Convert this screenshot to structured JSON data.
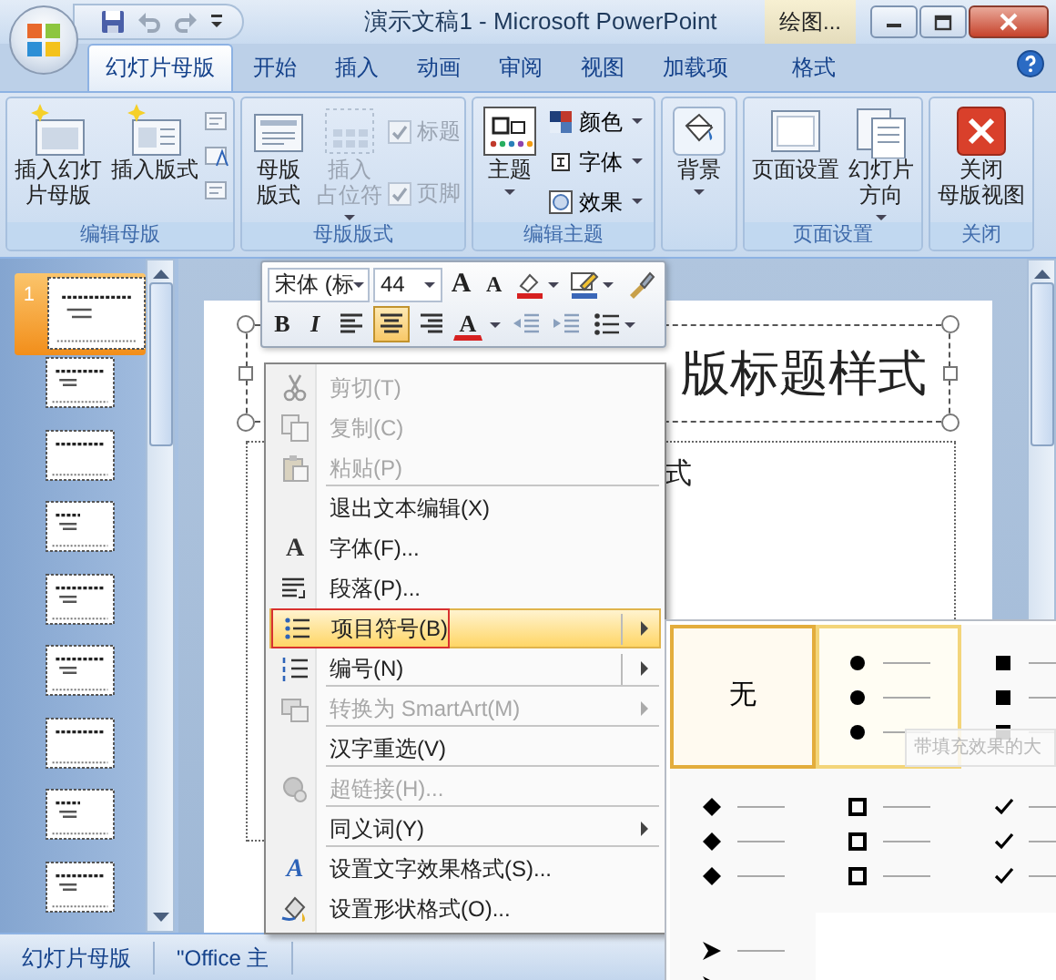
{
  "window": {
    "title": "演示文稿1 - Microsoft PowerPoint",
    "contextual_tab": "绘图..."
  },
  "tabs": [
    {
      "label": "幻灯片母版",
      "selected": true
    },
    {
      "label": "开始",
      "selected": false
    },
    {
      "label": "插入",
      "selected": false
    },
    {
      "label": "动画",
      "selected": false
    },
    {
      "label": "审阅",
      "selected": false
    },
    {
      "label": "视图",
      "selected": false
    },
    {
      "label": "加载项",
      "selected": false
    },
    {
      "label": "格式",
      "selected": false
    }
  ],
  "ribbon": [
    {
      "label": "编辑母版",
      "controls": [
        {
          "kind": "large",
          "label": [
            "插入幻灯",
            "片母版"
          ],
          "disabled": false,
          "dropdown": false
        },
        {
          "kind": "large",
          "label": [
            "插入版式"
          ],
          "disabled": false,
          "dropdown": false
        },
        {
          "kind": "icon-stack"
        }
      ]
    },
    {
      "label": "母版版式",
      "controls": [
        {
          "kind": "large",
          "label": [
            "母版",
            "版式"
          ],
          "disabled": false,
          "dropdown": false
        },
        {
          "kind": "large",
          "label": [
            "插入",
            "占位符"
          ],
          "disabled": true,
          "dropdown": true
        },
        {
          "kind": "checkboxes",
          "items": [
            {
              "label": "标题",
              "checked": true,
              "disabled": true
            },
            {
              "label": "页脚",
              "checked": true,
              "disabled": true
            }
          ]
        }
      ]
    },
    {
      "label": "编辑主题",
      "controls": [
        {
          "kind": "large",
          "label": [
            "主题"
          ],
          "disabled": false,
          "dropdown": true
        },
        {
          "kind": "small-list",
          "items": [
            {
              "label": "颜色"
            },
            {
              "label": "字体"
            },
            {
              "label": "效果"
            }
          ]
        }
      ]
    },
    {
      "controls": [
        {
          "kind": "large",
          "label": [
            "背景"
          ],
          "disabled": false,
          "dropdown": true
        }
      ]
    },
    {
      "label": "页面设置",
      "controls": [
        {
          "kind": "large",
          "label": [
            "页面设置"
          ],
          "disabled": false,
          "dropdown": false
        },
        {
          "kind": "large",
          "label": [
            "幻灯片",
            "方向"
          ],
          "disabled": false,
          "dropdown": true
        }
      ]
    },
    {
      "label": "关闭",
      "controls": [
        {
          "kind": "large",
          "label": [
            "关闭",
            "母版视图"
          ],
          "disabled": false,
          "dropdown": false
        }
      ]
    }
  ],
  "slides_pane": {
    "thumbnails": [
      {
        "kind": "master",
        "number": "1",
        "selected": true
      },
      {
        "kind": "layout",
        "selected": false
      },
      {
        "kind": "layout",
        "selected": false
      },
      {
        "kind": "layout",
        "selected": false
      },
      {
        "kind": "layout",
        "selected": false
      },
      {
        "kind": "layout",
        "selected": false
      },
      {
        "kind": "layout",
        "selected": false
      },
      {
        "kind": "layout",
        "selected": false
      },
      {
        "kind": "layout",
        "selected": false
      }
    ]
  },
  "slide": {
    "title": "版标题样式",
    "body": "式"
  },
  "mini_toolbar": {
    "font": "宋体 (标",
    "size": "44",
    "row1": [
      {
        "kind": "grow",
        "label": "A"
      },
      {
        "kind": "shrink",
        "label": "A"
      },
      {
        "kind": "highlight"
      },
      {
        "kind": "color-pen"
      },
      {
        "kind": "painter"
      }
    ],
    "row2": [
      {
        "kind": "bold",
        "label": "B",
        "selected": false
      },
      {
        "kind": "italic",
        "label": "I",
        "selected": false
      },
      {
        "kind": "align-left",
        "selected": false
      },
      {
        "kind": "align-center",
        "selected": true
      },
      {
        "kind": "align-right",
        "selected": false
      },
      {
        "kind": "font-color",
        "label": "A",
        "selected": false
      },
      {
        "kind": "outdent",
        "selected": false
      },
      {
        "kind": "indent",
        "selected": false
      },
      {
        "kind": "bullets",
        "selected": false
      }
    ]
  },
  "context_menu": [
    {
      "label": "剪切(T)",
      "disabled": true,
      "submenu": false,
      "selected": false,
      "separator": false
    },
    {
      "label": "复制(C)",
      "disabled": true,
      "submenu": false,
      "selected": false,
      "separator": false
    },
    {
      "label": "粘贴(P)",
      "disabled": true,
      "submenu": false,
      "selected": false,
      "separator": true
    },
    {
      "label": "退出文本编辑(X)",
      "disabled": false,
      "submenu": false,
      "selected": false,
      "separator": false
    },
    {
      "label": "字体(F)...",
      "icon_text": "A",
      "disabled": false,
      "submenu": false,
      "selected": false,
      "separator": false
    },
    {
      "label": "段落(P)...",
      "disabled": false,
      "submenu": false,
      "selected": false,
      "separator": false
    },
    {
      "label": "项目符号(B)",
      "disabled": false,
      "submenu": true,
      "selected": true,
      "separator": false
    },
    {
      "label": "编号(N)",
      "disabled": false,
      "submenu": true,
      "selected": false,
      "separator": true
    },
    {
      "label": "转换为 SmartArt(M)",
      "disabled": true,
      "submenu": true,
      "selected": false,
      "separator": true
    },
    {
      "label": "汉字重选(V)",
      "disabled": false,
      "submenu": false,
      "selected": false,
      "separator": true
    },
    {
      "label": "超链接(H)...",
      "disabled": true,
      "submenu": false,
      "selected": false,
      "separator": true
    },
    {
      "label": "同义词(Y)",
      "disabled": false,
      "submenu": true,
      "selected": false,
      "separator": true
    },
    {
      "label": "设置文字效果格式(S)...",
      "icon_text": "A",
      "disabled": false,
      "submenu": false,
      "selected": false,
      "separator": false
    },
    {
      "label": "设置形状格式(O)...",
      "disabled": false,
      "submenu": false,
      "selected": false,
      "separator": false
    }
  ],
  "bullet_gallery": {
    "options": [
      {
        "kind": "none",
        "label": "无",
        "selected": true,
        "hovered": false
      },
      {
        "kind": "filled-circle",
        "selected": false,
        "hovered": true
      },
      {
        "kind": "filled-square",
        "selected": false,
        "hovered": false
      },
      {
        "kind": "diamond",
        "selected": false,
        "hovered": false
      },
      {
        "kind": "hollow-square",
        "selected": false,
        "hovered": false
      },
      {
        "kind": "check",
        "selected": false,
        "hovered": false
      },
      {
        "kind": "arrowhead",
        "selected": false,
        "hovered": false
      }
    ],
    "tooltip": "带填充效果的大"
  },
  "status_bar": [
    "幻灯片母版",
    "\"Office 主"
  ]
}
